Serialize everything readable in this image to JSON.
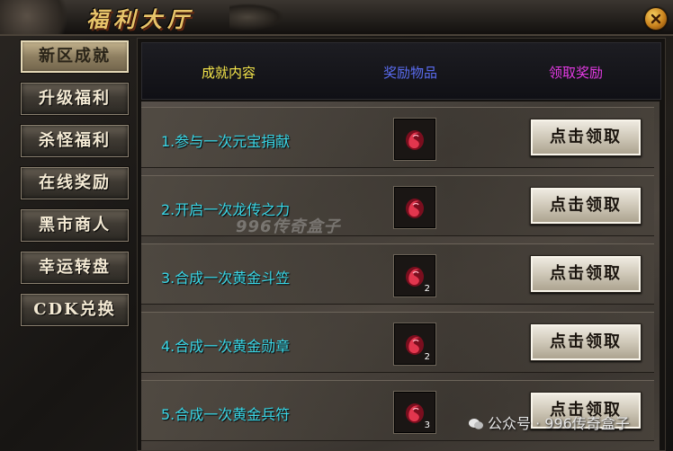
{
  "window": {
    "title": "福利大厅"
  },
  "nav": {
    "items": [
      {
        "label": "新区成就",
        "active": true
      },
      {
        "label": "升级福利"
      },
      {
        "label": "杀怪福利"
      },
      {
        "label": "在线奖励"
      },
      {
        "label": "黑市商人"
      },
      {
        "label": "幸运转盘"
      },
      {
        "label": "CDK兑换"
      }
    ]
  },
  "table": {
    "headers": [
      "成就内容",
      "奖励物品",
      "领取奖励"
    ],
    "rows": [
      {
        "text": "1.参与一次元宝捐献",
        "qty": "",
        "button": "点击领取"
      },
      {
        "text": "2.开启一次龙传之力",
        "qty": "",
        "button": "点击领取"
      },
      {
        "text": "3.合成一次黄金斗笠",
        "qty": "2",
        "button": "点击领取"
      },
      {
        "text": "4.合成一次黄金勋章",
        "qty": "2",
        "button": "点击领取"
      },
      {
        "text": "5.合成一次黄金兵符",
        "qty": "3",
        "button": "点击领取"
      }
    ]
  },
  "watermarks": {
    "center": "996传奇盒子",
    "corner": "公众号 · 996传奇盒子"
  },
  "icons": {
    "reward": "red-dragon-gem-icon",
    "close": "close-icon",
    "corner": "wechat-icon"
  },
  "colors": {
    "title": "#e8c46a",
    "col1": "#f4e54a",
    "col2": "#5a6cf0",
    "col3": "#e43ae4",
    "rowText": "#39d6e6"
  }
}
